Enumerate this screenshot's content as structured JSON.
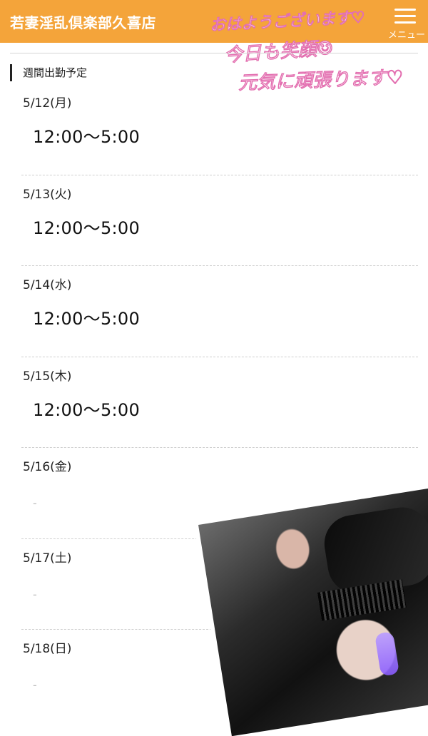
{
  "header": {
    "title": "若妻淫乱倶楽部久喜店",
    "menu_label": "メニュー",
    "banner_line1": "おはようございます♡",
    "banner_line2": "今日も笑顔☺",
    "banner_line3": "元気に頑張ります♡"
  },
  "section": {
    "title": "週間出勤予定"
  },
  "schedule": [
    {
      "date": "5/12(月)",
      "time": "12:00〜5:00"
    },
    {
      "date": "5/13(火)",
      "time": "12:00〜5:00"
    },
    {
      "date": "5/14(水)",
      "time": "12:00〜5:00"
    },
    {
      "date": "5/15(木)",
      "time": "12:00〜5:00"
    },
    {
      "date": "5/16(金)",
      "time": "-"
    },
    {
      "date": "5/17(土)",
      "time": "-"
    },
    {
      "date": "5/18(日)",
      "time": "-"
    }
  ],
  "colors": {
    "header_bg": "#f4a43a",
    "banner_pink": "#e36fb0",
    "off_text": "#bdbdbd"
  },
  "icons": {
    "menu": "hamburger-icon"
  }
}
